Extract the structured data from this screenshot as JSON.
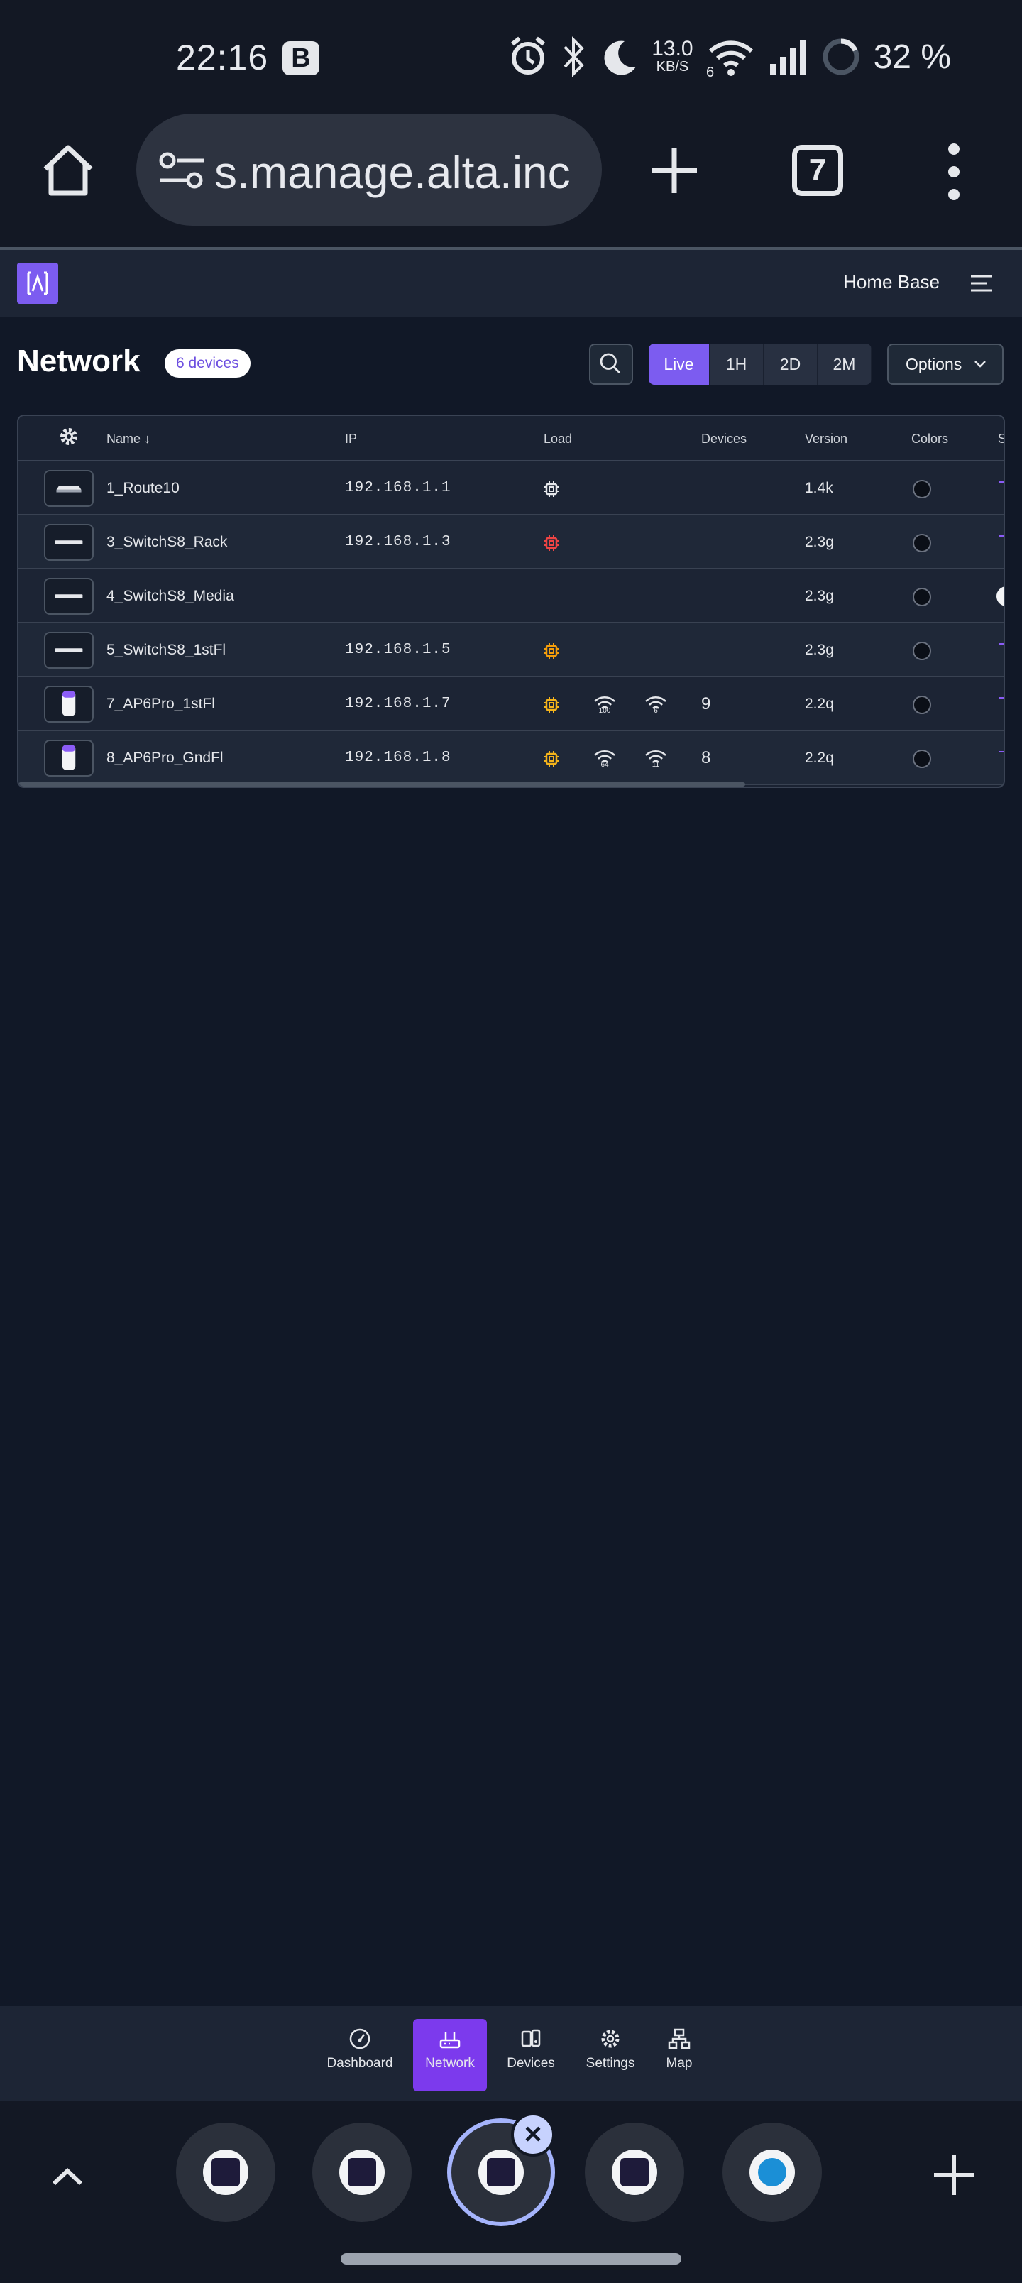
{
  "status_bar": {
    "time": "22:16",
    "notification_badge": "B",
    "network_speed": "13.0",
    "network_speed_unit": "KB/S",
    "wifi_label": "6",
    "battery": "32 %"
  },
  "browser": {
    "url": "s.manage.alta.inc",
    "tab_count": "7"
  },
  "app_header": {
    "site_name": "Home Base"
  },
  "toolbar": {
    "title": "Network",
    "device_count": "6 devices",
    "ranges": [
      "Live",
      "1H",
      "2D",
      "2M"
    ],
    "active_range": "Live",
    "options_label": "Options"
  },
  "table": {
    "columns": {
      "name": "Name",
      "ip": "IP",
      "load": "Load",
      "devices": "Devices",
      "version": "Version",
      "colors": "Colors",
      "extra": "S"
    },
    "rows": [
      {
        "name": "1_Route10",
        "ip": "192.168.1.1",
        "load_status": "normal",
        "load_color": "#e5e7eb",
        "wifi_a": "",
        "wifi_b": "",
        "devices": "",
        "version": "1.4k"
      },
      {
        "name": "3_SwitchS8_Rack",
        "ip": "192.168.1.3",
        "load_status": "high",
        "load_color": "#ef4444",
        "wifi_a": "",
        "wifi_b": "",
        "devices": "",
        "version": "2.3g"
      },
      {
        "name": "4_SwitchS8_Media",
        "ip": "",
        "load_status": "none",
        "load_color": "",
        "wifi_a": "",
        "wifi_b": "",
        "devices": "",
        "version": "2.3g"
      },
      {
        "name": "5_SwitchS8_1stFl",
        "ip": "192.168.1.5",
        "load_status": "medium",
        "load_color": "#f59e0b",
        "wifi_a": "",
        "wifi_b": "",
        "devices": "",
        "version": "2.3g"
      },
      {
        "name": "7_AP6Pro_1stFl",
        "ip": "192.168.1.7",
        "load_status": "medium",
        "load_color": "#f5b41b",
        "wifi_a": "100",
        "wifi_b": "6",
        "devices": "9",
        "version": "2.2q"
      },
      {
        "name": "8_AP6Pro_GndFl",
        "ip": "192.168.1.8",
        "load_status": "medium",
        "load_color": "#f5b41b",
        "wifi_a": "64",
        "wifi_b": "11",
        "devices": "8",
        "version": "2.2q"
      }
    ]
  },
  "bottom_nav": {
    "items": [
      {
        "label": "Dashboard",
        "icon": "gauge-icon"
      },
      {
        "label": "Network",
        "icon": "router-icon"
      },
      {
        "label": "Devices",
        "icon": "devices-icon"
      },
      {
        "label": "Settings",
        "icon": "gear-icon"
      },
      {
        "label": "Map",
        "icon": "sitemap-icon"
      }
    ],
    "active": "Network"
  },
  "taskbar": {
    "bubbles": [
      "alta-app",
      "alta-app",
      "alta-app",
      "alta-app",
      "webex-app"
    ]
  }
}
